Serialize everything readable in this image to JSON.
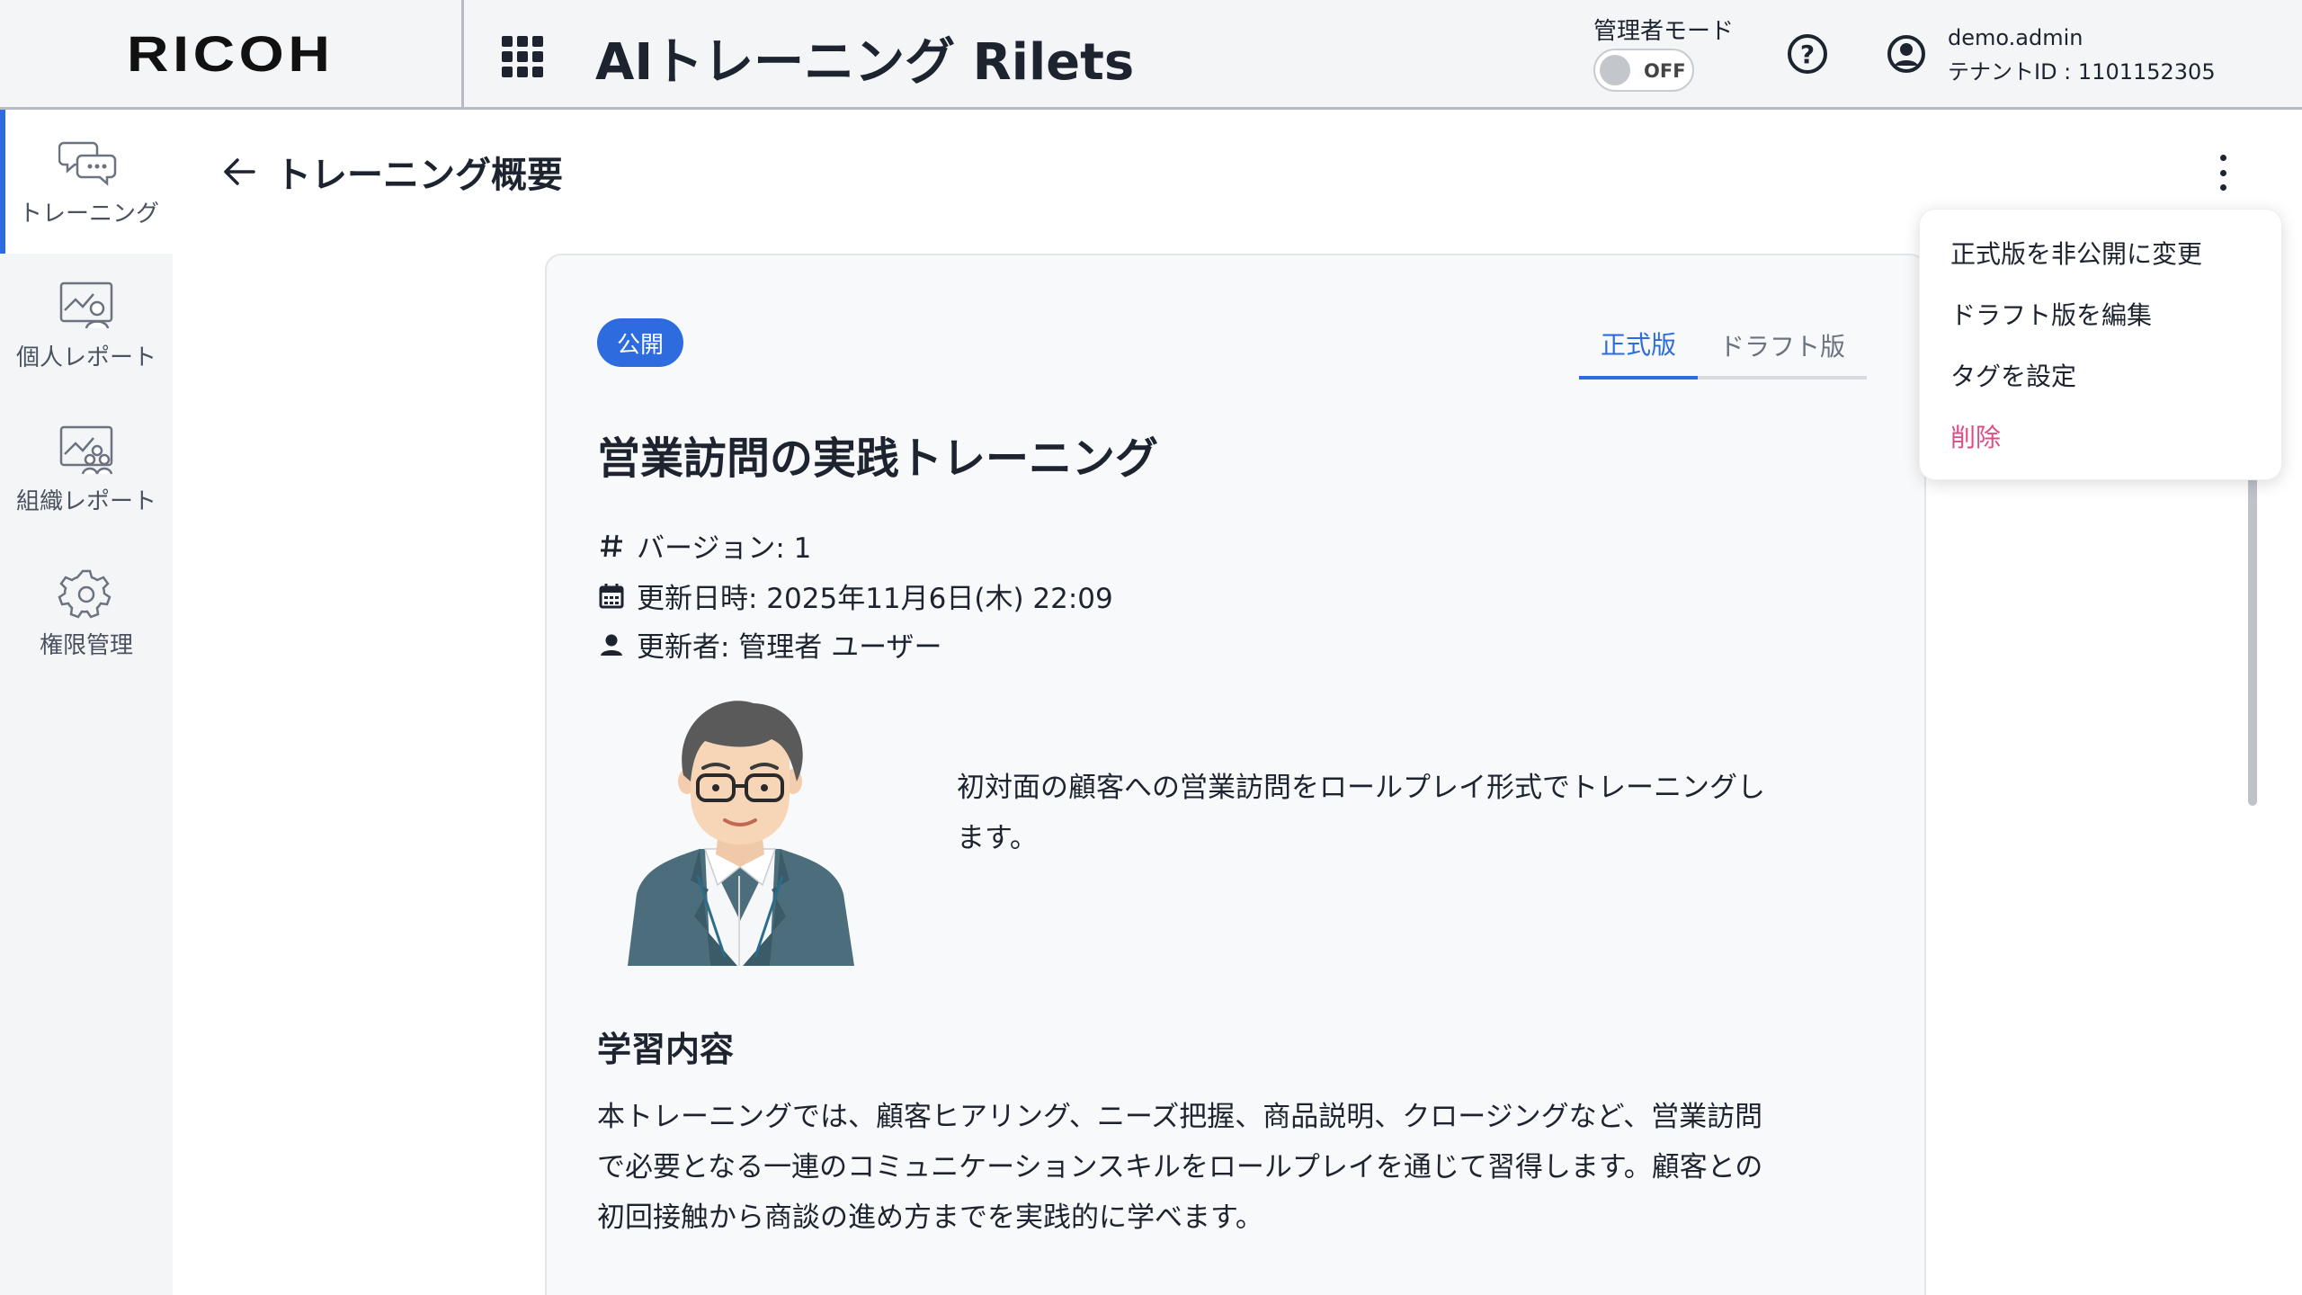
{
  "header": {
    "logo": "RICOH",
    "app_title": "AIトレーニング Rilets",
    "admin_mode_label": "管理者モード",
    "admin_toggle_state": "OFF",
    "help_symbol": "?",
    "user_name": "demo.admin",
    "tenant_id": "テナントID : 1101152305"
  },
  "sidebar": {
    "items": [
      {
        "label": "トレーニング",
        "icon": "chat-bubbles-icon",
        "active": true
      },
      {
        "label": "個人レポート",
        "icon": "person-report-icon",
        "active": false
      },
      {
        "label": "組織レポート",
        "icon": "group-report-icon",
        "active": false
      },
      {
        "label": "権限管理",
        "icon": "gear-icon",
        "active": false
      }
    ]
  },
  "main": {
    "page_title": "トレーニング概要",
    "status_badge": "公開",
    "tabs": [
      {
        "label": "正式版",
        "active": true
      },
      {
        "label": "ドラフト版",
        "active": false
      }
    ],
    "training_title": "営業訪問の実践トレーニング",
    "version": "バージョン: 1",
    "updated_at": "更新日時: 2025年11月6日(木) 22:09",
    "updated_by": "更新者: 管理者 ユーザー",
    "description": "初対面の顧客への営業訪問をロールプレイ形式でトレーニングします。",
    "section_title": "学習内容",
    "section_body": "本トレーニングでは、顧客ヒアリング、ニーズ把握、商品説明、クロージングなど、営業訪問で必要となる一連のコミュニケーションスキルをロールプレイを通じて習得します。顧客との初回接触から商談の進め方までを実践的に学べます。"
  },
  "menu": {
    "items": [
      {
        "label": "正式版を非公開に変更"
      },
      {
        "label": "ドラフト版を編集"
      },
      {
        "label": "タグを設定"
      },
      {
        "label": "削除"
      }
    ]
  },
  "colors": {
    "accent": "#2d6cdf",
    "danger": "#e04c86",
    "background": "#f4f5f7"
  }
}
